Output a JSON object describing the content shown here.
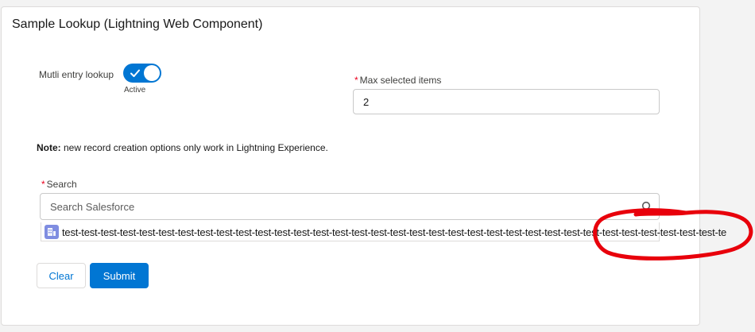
{
  "card": {
    "title": "Sample Lookup (Lightning Web Component)"
  },
  "multi_entry": {
    "label": "Mutli entry lookup",
    "status": "Active",
    "checked": true
  },
  "max_items": {
    "required_mark": "*",
    "label": "Max selected items",
    "value": "2"
  },
  "note": {
    "bold": "Note:",
    "text": " new record creation options only work in Lightning Experience."
  },
  "search": {
    "required_mark": "*",
    "label": "Search",
    "placeholder": "Search Salesforce"
  },
  "selected_item": {
    "icon": "record-icon",
    "text": "test-test-test-test-test-test-test-test-test-test-test-test-test-test-test-test-test-test-test-test-test-test-test-test-test-test-test-test-test-test-test-test-test-test-te"
  },
  "buttons": {
    "clear": "Clear",
    "submit": "Submit"
  },
  "colors": {
    "brand": "#0176d3",
    "annotation": "#e8000b",
    "required": "#ea001e"
  }
}
